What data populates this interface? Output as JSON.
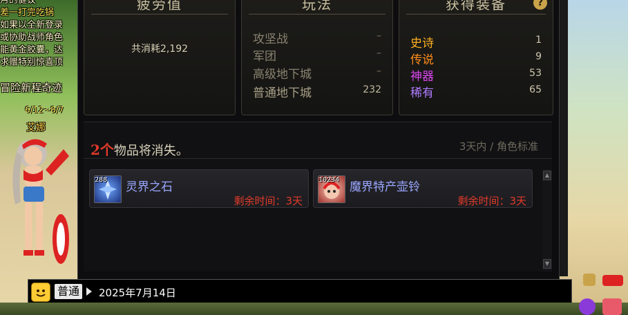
{
  "left_notice": {
    "lines": [
      "月的健议",
      "差一打完吃锅",
      "如果以全新登录",
      "或协助战师角色",
      "能黄金胶囊，达",
      "求赠特别惊喜顶"
    ],
    "event_title": "冒险新程奇迹",
    "date_range": "6/12~8/7",
    "npc_name": "艾娜"
  },
  "fatigue": {
    "title": "疲劳值",
    "consumed": "共消耗2,192"
  },
  "play": {
    "title": "玩法",
    "rows": [
      {
        "label": "攻坚战",
        "value": "–"
      },
      {
        "label": "军团",
        "value": "–"
      },
      {
        "label": "高级地下城",
        "value": "–"
      },
      {
        "label": "普通地下城",
        "value": "232"
      }
    ]
  },
  "equip": {
    "title": "获得装备",
    "help": "?",
    "rows": [
      {
        "label": "史诗",
        "value": "1",
        "color": "#ffb020"
      },
      {
        "label": "传说",
        "value": "9",
        "color": "#ff8c1a"
      },
      {
        "label": "神器",
        "value": "53",
        "color": "#d946ef"
      },
      {
        "label": "稀有",
        "value": "65",
        "color": "#b07cff"
      }
    ]
  },
  "vanish": {
    "count": "2个",
    "title_suffix": "物品将消失。",
    "hint": "3天内 / 角色标准",
    "items": [
      {
        "name": "灵界之石",
        "count": "288",
        "time": "剩余时间：3天",
        "icon": "crystal-icon"
      },
      {
        "name": "魔界特产壶铃",
        "count": "10234",
        "time": "剩余时间：3天",
        "icon": "kettlebell-icon"
      }
    ]
  },
  "chat": {
    "channel": "普通",
    "text": "2025年7月14日"
  }
}
